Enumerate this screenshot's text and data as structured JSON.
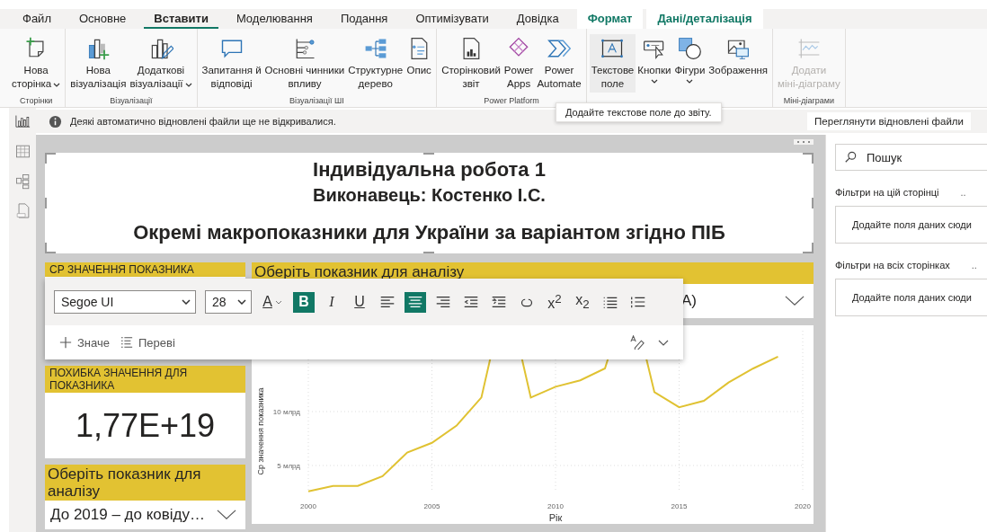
{
  "tabs": [
    {
      "label": "Файл",
      "selected": false,
      "kind": "normal"
    },
    {
      "label": "Основне",
      "selected": false,
      "kind": "normal"
    },
    {
      "label": "Вставити",
      "selected": true,
      "kind": "normal"
    },
    {
      "label": "Моделювання",
      "selected": false,
      "kind": "normal"
    },
    {
      "label": "Подання",
      "selected": false,
      "kind": "normal"
    },
    {
      "label": "Оптимізувати",
      "selected": false,
      "kind": "normal"
    },
    {
      "label": "Довідка",
      "selected": false,
      "kind": "normal"
    },
    {
      "label": "Формат",
      "selected": false,
      "kind": "contextual"
    },
    {
      "label": "Дані/деталізація",
      "selected": false,
      "kind": "contextual"
    }
  ],
  "ribbon": {
    "groups": [
      {
        "label": "Сторінки",
        "buttons": [
          {
            "lines": [
              "Нова",
              "сторінка"
            ],
            "dropdown": true,
            "selected": false,
            "disabled": false
          }
        ]
      },
      {
        "label": "Візуалізації",
        "buttons": [
          {
            "lines": [
              "Нова",
              "візуалізація"
            ],
            "dropdown": false,
            "selected": false,
            "disabled": false
          },
          {
            "lines": [
              "Додаткові",
              "візуалізації"
            ],
            "dropdown": true,
            "selected": false,
            "disabled": false
          }
        ]
      },
      {
        "label": "Візуалізації ШІ",
        "buttons": [
          {
            "lines": [
              "Запитання й",
              "відповіді"
            ],
            "dropdown": false,
            "selected": false,
            "disabled": false
          },
          {
            "lines": [
              "Основні чинники",
              "впливу"
            ],
            "dropdown": false,
            "selected": false,
            "disabled": false
          },
          {
            "lines": [
              "Структурне",
              "дерево"
            ],
            "dropdown": false,
            "selected": false,
            "disabled": false
          },
          {
            "lines": [
              "Опис"
            ],
            "dropdown": false,
            "selected": false,
            "disabled": false
          }
        ]
      },
      {
        "label": "Power Platform",
        "buttons": [
          {
            "lines": [
              "Сторінковий",
              "звіт"
            ],
            "dropdown": false,
            "selected": false,
            "disabled": false
          },
          {
            "lines": [
              "Power",
              "Apps"
            ],
            "dropdown": false,
            "selected": false,
            "disabled": false
          },
          {
            "lines": [
              "Power",
              "Automate"
            ],
            "dropdown": false,
            "selected": false,
            "disabled": false
          }
        ]
      },
      {
        "buttons": [
          {
            "lines": [
              "Текстове",
              "поле"
            ],
            "dropdown": false,
            "selected": true,
            "disabled": false
          },
          {
            "lines": [
              "Кнопки"
            ],
            "dropdown": true,
            "selected": false,
            "disabled": false
          },
          {
            "lines": [
              "Фігури"
            ],
            "dropdown": true,
            "selected": false,
            "disabled": false
          },
          {
            "lines": [
              "Зображення"
            ],
            "dropdown": false,
            "selected": false,
            "disabled": false
          }
        ]
      },
      {
        "label": "Міні-діаграми",
        "buttons": [
          {
            "lines": [
              "Додати",
              "міні-діаграму"
            ],
            "dropdown": false,
            "selected": false,
            "disabled": true
          }
        ]
      }
    ]
  },
  "tooltip": {
    "text": "Додайте текстове поле до звіту."
  },
  "nav": [
    {
      "selected": true
    },
    {
      "selected": false
    },
    {
      "selected": false
    },
    {
      "selected": false
    }
  ],
  "info_bar": {
    "message": "Деякі автоматично відновлені файли ще не відкривалися.",
    "button": "Переглянути відновлені файли"
  },
  "text_box": {
    "lines": [
      {
        "text": "Індивідуальна робота 1",
        "kind": "title"
      },
      {
        "text": "Виконавець: Костенко І.С.",
        "kind": "subtitle"
      },
      {
        "text": "Окремі макропоказники для України за варіантом згідно ПІБ",
        "kind": "heading"
      }
    ]
  },
  "average_card": {
    "header": "СР ЗНАЧЕННЯ ПОКАЗНИКА"
  },
  "error_card": {
    "header": "ПОХИБКА ЗНАЧЕННЯ ДЛЯ ПОКАЗНИКА",
    "value": "1,77E+19"
  },
  "period_slicer": {
    "header": "Оберіть показник для аналізу",
    "value": "До 2019 – до ковіду…"
  },
  "indicator_slicer": {
    "header": "Оберіть показник для аналізу",
    "value": "А)"
  },
  "line_chart": {
    "chart_data": {
      "type": "line",
      "xlabel": "Рік",
      "ylabel": "Ср значення показника",
      "x": [
        2000,
        2001,
        2002,
        2003,
        2004,
        2005,
        2006,
        2007,
        2008,
        2009,
        2010,
        2011,
        2012,
        2013,
        2014,
        2015,
        2016,
        2017,
        2018,
        2019
      ],
      "series": [
        {
          "color": "#e0c232",
          "values": [
            2.6,
            3.1,
            3.1,
            4.0,
            6.2,
            7.1,
            8.7,
            11.3,
            null,
            11.3,
            12.3,
            12.9,
            14.0,
            null,
            11.8,
            10.4,
            11.0,
            12.7,
            14.0,
            15.1
          ]
        }
      ],
      "xlim": [
        2000,
        2020
      ],
      "ylim": [
        2.5,
        17.5
      ],
      "xticks": [
        2000,
        2005,
        2010,
        2015,
        2020
      ],
      "yticks": [
        {
          "value": 5,
          "label": "5 млрд"
        },
        {
          "value": 10,
          "label": "10 млрд"
        }
      ],
      "grid": true
    }
  },
  "format_toolbar": {
    "font": "Segoe UI",
    "size": "28",
    "buttons": [
      {
        "kind": "font-color",
        "label": "A",
        "selected": false
      },
      {
        "kind": "bold",
        "label": "B",
        "selected": true
      },
      {
        "kind": "italic",
        "label": "I",
        "selected": false
      },
      {
        "kind": "underline",
        "label": "U",
        "selected": false
      },
      {
        "kind": "align-left",
        "selected": false
      },
      {
        "kind": "align-center",
        "selected": true
      },
      {
        "kind": "align-right",
        "selected": false
      },
      {
        "kind": "outdent",
        "selected": false
      },
      {
        "kind": "indent",
        "selected": false
      },
      {
        "kind": "link",
        "selected": false
      },
      {
        "kind": "superscript",
        "label": "x$^{2}$",
        "selected": false
      },
      {
        "kind": "subscript",
        "label": "x$_{2}$",
        "selected": false
      },
      {
        "kind": "bullets",
        "selected": false
      },
      {
        "kind": "numbering",
        "selected": false
      }
    ],
    "actions": [
      {
        "kind": "add",
        "label": "Значе"
      },
      {
        "kind": "review",
        "label": "Переві"
      }
    ]
  },
  "filter_pane": {
    "search": {
      "placeholder": "Пошук"
    },
    "sections": [
      {
        "title": "Фільтри на цій сторінці",
        "more": "..",
        "drop_hint": "Додайте поля даних сюди"
      },
      {
        "title": "Фільтри на всіх сторінках",
        "more": "..",
        "drop_hint": "Додайте поля даних сюди"
      }
    ]
  }
}
